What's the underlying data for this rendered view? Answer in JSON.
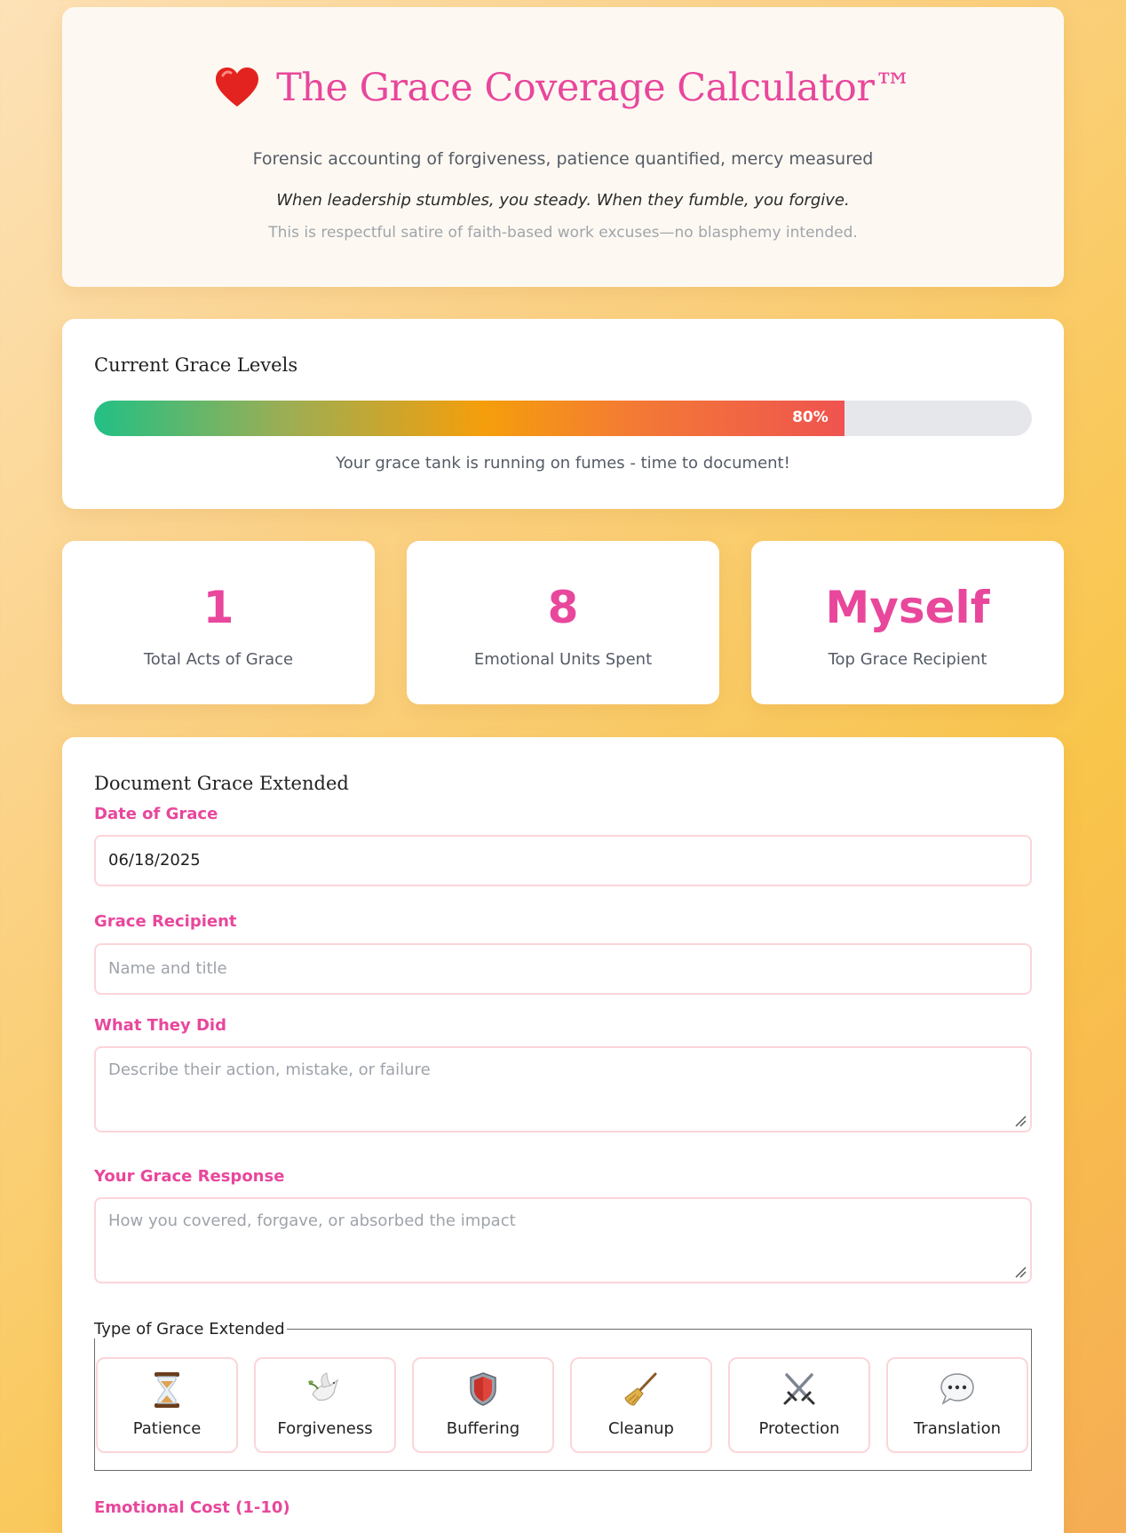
{
  "header": {
    "title": "The Grace Coverage Calculator™",
    "subtitle": "Forensic accounting of forgiveness, patience quantified, mercy measured",
    "tagline": "When leadership stumbles, you steady. When they fumble, you forgive.",
    "disclaimer": "This is respectful satire of faith-based work excuses—no blasphemy intended.",
    "icon": "heart-icon"
  },
  "grace_level": {
    "title": "Current Grace Levels",
    "percent_label": "80%",
    "fill_fraction": 0.8,
    "message": "Your grace tank is running on fumes - time to document!"
  },
  "stats": [
    {
      "value": "1",
      "label": "Total Acts of Grace"
    },
    {
      "value": "8",
      "label": "Emotional Units Spent"
    },
    {
      "value": "Myself",
      "label": "Top Grace Recipient"
    }
  ],
  "form": {
    "title": "Document Grace Extended",
    "date": {
      "label": "Date of Grace",
      "value": "06/18/2025"
    },
    "recipient": {
      "label": "Grace Recipient",
      "placeholder": "Name and title"
    },
    "what_they_did": {
      "label": "What They Did",
      "placeholder": "Describe their action, mistake, or failure"
    },
    "response": {
      "label": "Your Grace Response",
      "placeholder": "How you covered, forgave, or absorbed the impact"
    },
    "types_legend": "Type of Grace Extended",
    "types": [
      {
        "label": "Patience",
        "icon": "hourglass-icon"
      },
      {
        "label": "Forgiveness",
        "icon": "dove-icon"
      },
      {
        "label": "Buffering",
        "icon": "shield-icon"
      },
      {
        "label": "Cleanup",
        "icon": "broom-icon"
      },
      {
        "label": "Protection",
        "icon": "crossed-swords-icon"
      },
      {
        "label": "Translation",
        "icon": "speech-bubble-icon"
      }
    ],
    "cost_label": "Emotional Cost (1-10)"
  },
  "colors": {
    "accent": "#e8479c",
    "field_border": "#fcd5d9"
  }
}
